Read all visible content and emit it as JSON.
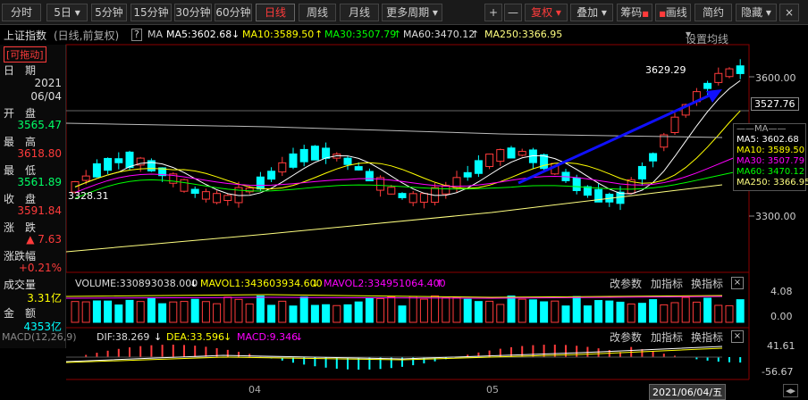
{
  "toolbar": {
    "tabs": [
      "分时",
      "5日",
      "5分钟",
      "15分钟",
      "30分钟",
      "60分钟",
      "日线",
      "周线",
      "月线",
      "更多周期"
    ],
    "active": "日线",
    "plus": "+",
    "minus": "—",
    "adjust": "复权",
    "overlay": "叠加",
    "chip": "筹码",
    "draw": "画线",
    "simple": "简约",
    "hide": "隐藏",
    "close": "×"
  },
  "info": {
    "name": "上证指数",
    "mode": "(日线,前复权)",
    "help": "?",
    "ma": "MA",
    "ma5": "MA5:3602.68",
    "ma10": "MA10:3589.50",
    "ma30": "MA30:3507.79",
    "ma60": "MA60:3470.12",
    "ma250": "MA250:3366.95",
    "settings": "设置均线"
  },
  "panel": {
    "date_label": "日　期",
    "year": "2021",
    "date": "06/04",
    "open_label": "开　盘",
    "open": "3565.47",
    "high_label": "最　高",
    "high": "3618.80",
    "low_label": "最　低",
    "low": "3561.89",
    "close_label": "收　盘",
    "close": "3591.84",
    "change_label": "涨　跌",
    "change": "▲ 7.63",
    "pct_label": "涨跌幅",
    "pct": "+0.21%",
    "vol_label": "成交量",
    "vol": "3.31亿",
    "amt_label": "金　额",
    "amt": "4353亿"
  },
  "badge": "[可拖动]",
  "price": {
    "high_mark": "3629.29",
    "low_mark": "3328.31",
    "last": "3527.76",
    "y3600": "3600.00",
    "y3300": "3300.00"
  },
  "mabox": {
    "title": "MA",
    "ma5": "MA5: 3602.68",
    "ma10": "MA10: 3589.50",
    "ma30": "MA30: 3507.79",
    "ma60": "MA60: 3470.12",
    "ma250": "MA250: 3366.95"
  },
  "volume": {
    "text": "VOLUME:330893038.000",
    "mavol1": "MAVOL1:343603934.600",
    "mavol2": "MAVOL2:334951064.400",
    "axis_top": "4.08",
    "axis_bot": "0.00"
  },
  "macd": {
    "name": "MACD(12,26,9)",
    "dif": "DIF:38.269",
    "dea": "DEA:33.596",
    "macd": "MACD:9.346",
    "axis_top": "41.61",
    "axis_bot": "-56.67"
  },
  "sub": {
    "params": "改参数",
    "add": "加指标",
    "switch": "换指标",
    "close": "×"
  },
  "xaxis": {
    "m4": "04",
    "m5": "05",
    "cursor": "2021/06/04/五"
  },
  "chart_data": {
    "type": "candlestick",
    "x_range": [
      "2021-03",
      "2021-06-04"
    ],
    "ylim": [
      3250,
      3650
    ],
    "last": {
      "date": "2021-06-04",
      "open": 3565.47,
      "high": 3618.8,
      "low": 3561.89,
      "close": 3591.84
    },
    "high_mark": 3629.29,
    "low_mark": 3328.31,
    "ma": {
      "MA5": 3602.68,
      "MA10": 3589.5,
      "MA30": 3507.79,
      "MA60": 3470.12,
      "MA250": 3366.95
    }
  },
  "colors": {
    "up": "#ff3b3b",
    "down": "#00ffff",
    "ma5": "#ffffff",
    "ma10": "#ffff00",
    "ma30": "#ff00ff",
    "ma60": "#00ff00",
    "ma250": "#ffff80",
    "arrow": "#1010ff"
  }
}
